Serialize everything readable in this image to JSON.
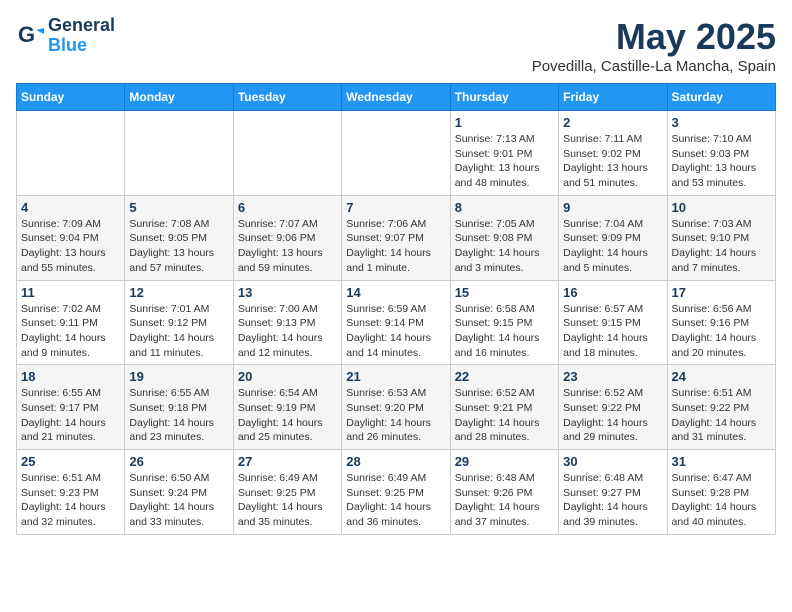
{
  "header": {
    "logo_line1": "General",
    "logo_line2": "Blue",
    "title": "May 2025",
    "subtitle": "Povedilla, Castille-La Mancha, Spain"
  },
  "weekdays": [
    "Sunday",
    "Monday",
    "Tuesday",
    "Wednesday",
    "Thursday",
    "Friday",
    "Saturday"
  ],
  "weeks": [
    [
      {
        "day": "",
        "info": ""
      },
      {
        "day": "",
        "info": ""
      },
      {
        "day": "",
        "info": ""
      },
      {
        "day": "",
        "info": ""
      },
      {
        "day": "1",
        "info": "Sunrise: 7:13 AM\nSunset: 9:01 PM\nDaylight: 13 hours\nand 48 minutes."
      },
      {
        "day": "2",
        "info": "Sunrise: 7:11 AM\nSunset: 9:02 PM\nDaylight: 13 hours\nand 51 minutes."
      },
      {
        "day": "3",
        "info": "Sunrise: 7:10 AM\nSunset: 9:03 PM\nDaylight: 13 hours\nand 53 minutes."
      }
    ],
    [
      {
        "day": "4",
        "info": "Sunrise: 7:09 AM\nSunset: 9:04 PM\nDaylight: 13 hours\nand 55 minutes."
      },
      {
        "day": "5",
        "info": "Sunrise: 7:08 AM\nSunset: 9:05 PM\nDaylight: 13 hours\nand 57 minutes."
      },
      {
        "day": "6",
        "info": "Sunrise: 7:07 AM\nSunset: 9:06 PM\nDaylight: 13 hours\nand 59 minutes."
      },
      {
        "day": "7",
        "info": "Sunrise: 7:06 AM\nSunset: 9:07 PM\nDaylight: 14 hours\nand 1 minute."
      },
      {
        "day": "8",
        "info": "Sunrise: 7:05 AM\nSunset: 9:08 PM\nDaylight: 14 hours\nand 3 minutes."
      },
      {
        "day": "9",
        "info": "Sunrise: 7:04 AM\nSunset: 9:09 PM\nDaylight: 14 hours\nand 5 minutes."
      },
      {
        "day": "10",
        "info": "Sunrise: 7:03 AM\nSunset: 9:10 PM\nDaylight: 14 hours\nand 7 minutes."
      }
    ],
    [
      {
        "day": "11",
        "info": "Sunrise: 7:02 AM\nSunset: 9:11 PM\nDaylight: 14 hours\nand 9 minutes."
      },
      {
        "day": "12",
        "info": "Sunrise: 7:01 AM\nSunset: 9:12 PM\nDaylight: 14 hours\nand 11 minutes."
      },
      {
        "day": "13",
        "info": "Sunrise: 7:00 AM\nSunset: 9:13 PM\nDaylight: 14 hours\nand 12 minutes."
      },
      {
        "day": "14",
        "info": "Sunrise: 6:59 AM\nSunset: 9:14 PM\nDaylight: 14 hours\nand 14 minutes."
      },
      {
        "day": "15",
        "info": "Sunrise: 6:58 AM\nSunset: 9:15 PM\nDaylight: 14 hours\nand 16 minutes."
      },
      {
        "day": "16",
        "info": "Sunrise: 6:57 AM\nSunset: 9:15 PM\nDaylight: 14 hours\nand 18 minutes."
      },
      {
        "day": "17",
        "info": "Sunrise: 6:56 AM\nSunset: 9:16 PM\nDaylight: 14 hours\nand 20 minutes."
      }
    ],
    [
      {
        "day": "18",
        "info": "Sunrise: 6:55 AM\nSunset: 9:17 PM\nDaylight: 14 hours\nand 21 minutes."
      },
      {
        "day": "19",
        "info": "Sunrise: 6:55 AM\nSunset: 9:18 PM\nDaylight: 14 hours\nand 23 minutes."
      },
      {
        "day": "20",
        "info": "Sunrise: 6:54 AM\nSunset: 9:19 PM\nDaylight: 14 hours\nand 25 minutes."
      },
      {
        "day": "21",
        "info": "Sunrise: 6:53 AM\nSunset: 9:20 PM\nDaylight: 14 hours\nand 26 minutes."
      },
      {
        "day": "22",
        "info": "Sunrise: 6:52 AM\nSunset: 9:21 PM\nDaylight: 14 hours\nand 28 minutes."
      },
      {
        "day": "23",
        "info": "Sunrise: 6:52 AM\nSunset: 9:22 PM\nDaylight: 14 hours\nand 29 minutes."
      },
      {
        "day": "24",
        "info": "Sunrise: 6:51 AM\nSunset: 9:22 PM\nDaylight: 14 hours\nand 31 minutes."
      }
    ],
    [
      {
        "day": "25",
        "info": "Sunrise: 6:51 AM\nSunset: 9:23 PM\nDaylight: 14 hours\nand 32 minutes."
      },
      {
        "day": "26",
        "info": "Sunrise: 6:50 AM\nSunset: 9:24 PM\nDaylight: 14 hours\nand 33 minutes."
      },
      {
        "day": "27",
        "info": "Sunrise: 6:49 AM\nSunset: 9:25 PM\nDaylight: 14 hours\nand 35 minutes."
      },
      {
        "day": "28",
        "info": "Sunrise: 6:49 AM\nSunset: 9:25 PM\nDaylight: 14 hours\nand 36 minutes."
      },
      {
        "day": "29",
        "info": "Sunrise: 6:48 AM\nSunset: 9:26 PM\nDaylight: 14 hours\nand 37 minutes."
      },
      {
        "day": "30",
        "info": "Sunrise: 6:48 AM\nSunset: 9:27 PM\nDaylight: 14 hours\nand 39 minutes."
      },
      {
        "day": "31",
        "info": "Sunrise: 6:47 AM\nSunset: 9:28 PM\nDaylight: 14 hours\nand 40 minutes."
      }
    ]
  ]
}
